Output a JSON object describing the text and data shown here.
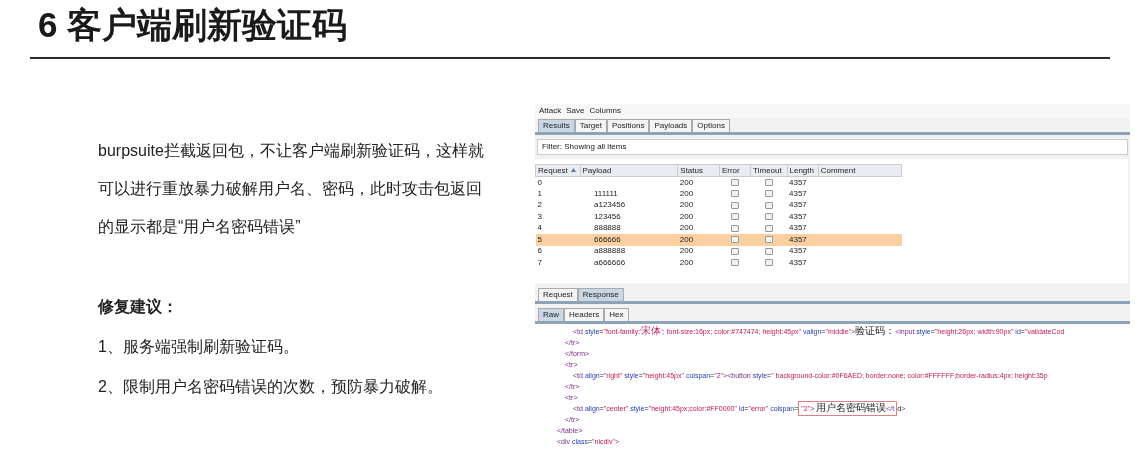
{
  "slide": {
    "title": "6 客户端刷新验证码",
    "paragraph": "burpsuite拦截返回包，不让客户端刷新验证码，这样就可以进行重放暴力破解用户名、密码，此时攻击包返回的显示都是“用户名密码错误”",
    "advice_heading": "修复建议：",
    "advice_items": [
      "1、服务端强制刷新验证码。",
      "2、限制用户名密码错误的次数，预防暴力破解。"
    ]
  },
  "burp": {
    "menu": [
      "Attack",
      "Save",
      "Columns"
    ],
    "tabs": [
      {
        "label": "Results",
        "selected": true
      },
      {
        "label": "Target",
        "selected": false
      },
      {
        "label": "Positions",
        "selected": false
      },
      {
        "label": "Payloads",
        "selected": false
      },
      {
        "label": "Options",
        "selected": false
      }
    ],
    "filter": "Filter: Showing all items",
    "columns": [
      "Request",
      "Payload",
      "Status",
      "Error",
      "Timeout",
      "Length",
      "Comment"
    ],
    "rows": [
      {
        "request": "0",
        "payload": "",
        "status": "200",
        "error": false,
        "timeout": false,
        "length": "4357",
        "selected": false
      },
      {
        "request": "1",
        "payload": "111111",
        "status": "200",
        "error": false,
        "timeout": false,
        "length": "4357",
        "selected": false
      },
      {
        "request": "2",
        "payload": "a123456",
        "status": "200",
        "error": false,
        "timeout": false,
        "length": "4357",
        "selected": false
      },
      {
        "request": "3",
        "payload": "123456",
        "status": "200",
        "error": false,
        "timeout": false,
        "length": "4357",
        "selected": false
      },
      {
        "request": "4",
        "payload": "888888",
        "status": "200",
        "error": false,
        "timeout": false,
        "length": "4357",
        "selected": false
      },
      {
        "request": "5",
        "payload": "666666",
        "status": "200",
        "error": false,
        "timeout": false,
        "length": "4357",
        "selected": true
      },
      {
        "request": "6",
        "payload": "a888888",
        "status": "200",
        "error": false,
        "timeout": false,
        "length": "4357",
        "selected": false
      },
      {
        "request": "7",
        "payload": "a666666",
        "status": "200",
        "error": false,
        "timeout": false,
        "length": "4357",
        "selected": false
      }
    ],
    "message_tabs": [
      {
        "label": "Request",
        "selected": false
      },
      {
        "label": "Response",
        "selected": true
      }
    ],
    "view_tabs": [
      {
        "label": "Raw",
        "selected": true
      },
      {
        "label": "Headers",
        "selected": false
      },
      {
        "label": "Hex",
        "selected": false
      }
    ],
    "code": [
      {
        "children": [
          {
            "children": [
              {
                "segments": [
                  {
                    "text": "<td style=\"font-family:'宋体'; font-size:16px; color:#747474; height:45px\" valign=\"middle\">验证码：<input style=\"height:26px; width:90px\" id=\"validateCod",
                    "boxed": false
                  }
                ]
              }
            ]
          },
          {
            "segments": [
              {
                "text": "</tr>",
                "boxed": false
              }
            ]
          },
          {
            "segments": [
              {
                "text": "</form>",
                "boxed": false
              }
            ]
          },
          {
            "segments": [
              {
                "text": "<tr>",
                "boxed": false
              }
            ],
            "children": [
              {
                "segments": [
                  {
                    "text": "<td align=\"right\" style=\"height:45px\" colspan=\"2\"><button style=\" background-color:#0F6AED; border:none; color:#FFFFFF;border-radius:4px; height:35p",
                    "boxed": false
                  }
                ]
              }
            ]
          },
          {
            "segments": [
              {
                "text": "</tr>",
                "boxed": false
              }
            ]
          },
          {
            "segments": [
              {
                "text": "<tr>",
                "boxed": false
              }
            ],
            "children": [
              {
                "segments": [
                  {
                    "text": "<td align=\"center\" style=\"height:45px;color:#FF0000\" id=\"error\" colspan=",
                    "boxed": false
                  },
                  {
                    "text": "\"2\"> 用户名密码错误</t",
                    "boxed": true
                  },
                  {
                    "text": "d>",
                    "boxed": false
                  }
                ]
              }
            ]
          },
          {
            "segments": [
              {
                "text": "</tr>",
                "boxed": false
              }
            ]
          }
        ]
      },
      {
        "segments": [
          {
            "text": "</table>",
            "boxed": false
          }
        ]
      },
      {
        "segments": [
          {
            "text": "<div class=\"nicdiv\">",
            "boxed": false
          }
        ]
      }
    ]
  }
}
